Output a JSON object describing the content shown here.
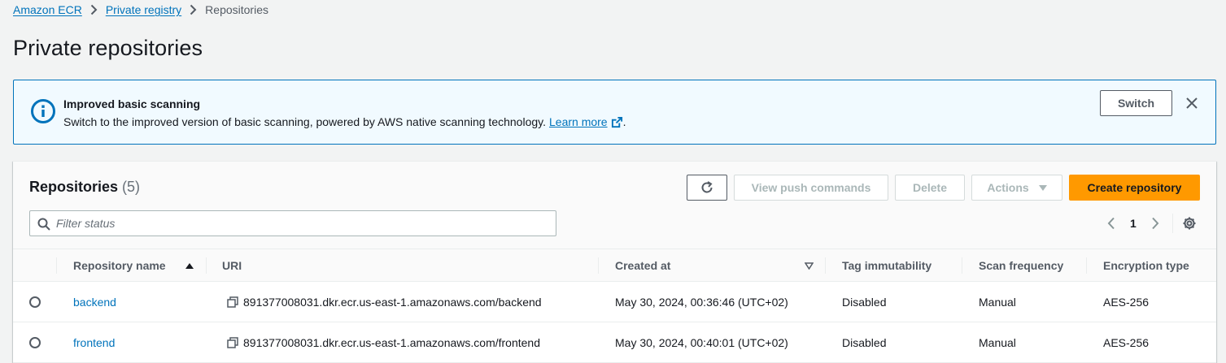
{
  "breadcrumb": {
    "items": [
      "Amazon ECR",
      "Private registry"
    ],
    "current": "Repositories"
  },
  "page": {
    "title": "Private repositories"
  },
  "flash": {
    "title": "Improved basic scanning",
    "body": "Switch to the improved version of basic scanning, powered by AWS native scanning technology.",
    "link": "Learn more",
    "suffix": ".",
    "switch_label": "Switch",
    "icon": "info-icon",
    "color": "#0073bb"
  },
  "panel": {
    "title": "Repositories",
    "count": "(5)",
    "buttons": {
      "push": "View push commands",
      "delete": "Delete",
      "actions": "Actions",
      "create": "Create repository"
    },
    "filter_placeholder": "Filter status",
    "page": "1"
  },
  "table": {
    "columns": [
      "Repository name",
      "URI",
      "Created at",
      "Tag immutability",
      "Scan frequency",
      "Encryption type"
    ],
    "rows": [
      {
        "name": "backend",
        "uri": "891377008031.dkr.ecr.us-east-1.amazonaws.com/backend",
        "created": "May 30, 2024, 00:36:46 (UTC+02)",
        "tag": "Disabled",
        "scan": "Manual",
        "enc": "AES-256"
      },
      {
        "name": "frontend",
        "uri": "891377008031.dkr.ecr.us-east-1.amazonaws.com/frontend",
        "created": "May 30, 2024, 00:40:01 (UTC+02)",
        "tag": "Disabled",
        "scan": "Manual",
        "enc": "AES-256"
      }
    ]
  },
  "colors": {
    "accent": "#ff9900",
    "link": "#0073bb",
    "text": "#16191f"
  }
}
